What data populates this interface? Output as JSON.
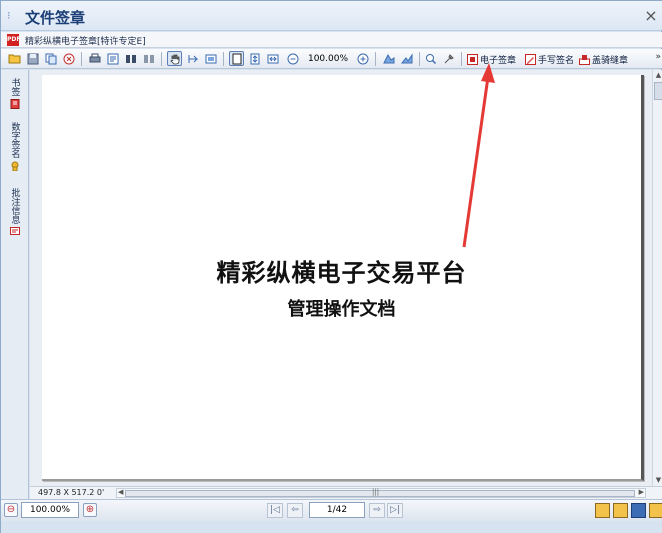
{
  "window": {
    "title": "文件签章",
    "close_glyph": "×",
    "dots_glyph": "⁝"
  },
  "document_tab": {
    "label": "精彩纵横电子签章[特许专定E]",
    "icon": "pdf-file-icon"
  },
  "toolbar": {
    "zoom_value": "100.00%",
    "icons": [
      "open-folder-icon",
      "save-icon",
      "copy-icon",
      "close-doc-icon",
      "print-icon",
      "properties-icon",
      "find-icon",
      "find-next-icon",
      "hand-tool-icon",
      "select-text-icon",
      "snapshot-icon",
      "single-page-icon",
      "fit-page-icon",
      "fit-width-icon",
      "zoom-out-icon",
      "zoom-in-icon",
      "rotate-left-icon",
      "rotate-right-icon",
      "search-icon",
      "tools-icon"
    ],
    "electronic_seal": "电子签章",
    "handwritten_signature": "手写签名",
    "riding_seal": "盖骑缝章",
    "more_glyph": "»"
  },
  "side_panel": {
    "tabs": [
      {
        "label": "书签",
        "icon": "bookmark-icon"
      },
      {
        "label": "数字签名",
        "icon": "digital-signature-icon"
      },
      {
        "label": "批注信息",
        "icon": "annotation-icon"
      }
    ]
  },
  "page": {
    "title": "精彩纵横电子交易平台",
    "subtitle": "管理操作文档"
  },
  "page_size_label": "497.8 X 517.2 0'",
  "status_bar": {
    "zoom_value": "100.00%",
    "zoom_out_glyph": "⊖",
    "zoom_in_glyph": "⊕",
    "page_indicator": "1/42",
    "first_glyph": "|◁",
    "prev_glyph": "⇦",
    "next_glyph": "⇨",
    "last_glyph": "▷|"
  },
  "colors": {
    "arrow": "#e53935",
    "title_text": "#1a3e75",
    "seal_red": "#d32020"
  }
}
